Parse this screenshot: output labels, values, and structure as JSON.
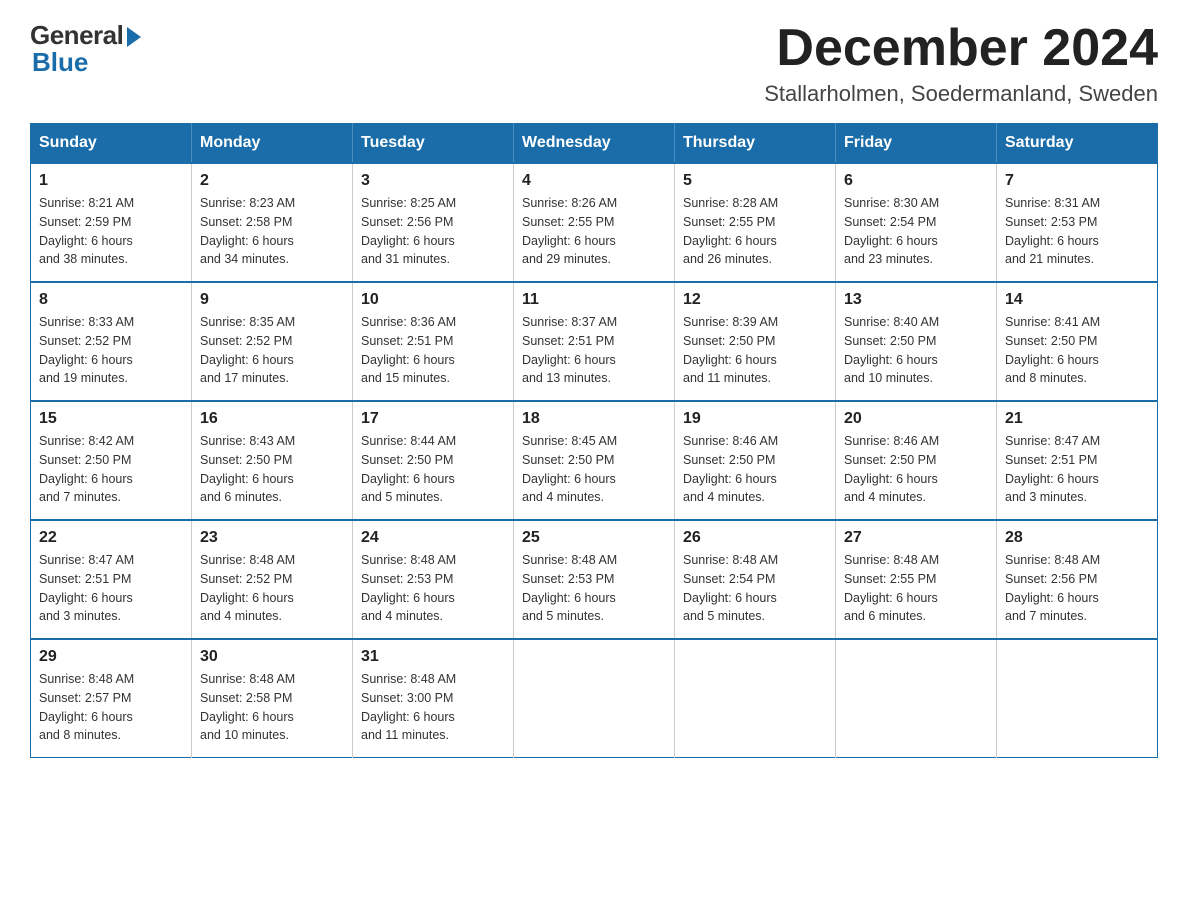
{
  "logo": {
    "general": "General",
    "blue": "Blue"
  },
  "header": {
    "month": "December 2024",
    "location": "Stallarholmen, Soedermanland, Sweden"
  },
  "weekdays": [
    "Sunday",
    "Monday",
    "Tuesday",
    "Wednesday",
    "Thursday",
    "Friday",
    "Saturday"
  ],
  "weeks": [
    [
      {
        "day": "1",
        "sunrise": "8:21 AM",
        "sunset": "2:59 PM",
        "daylight": "6 hours and 38 minutes."
      },
      {
        "day": "2",
        "sunrise": "8:23 AM",
        "sunset": "2:58 PM",
        "daylight": "6 hours and 34 minutes."
      },
      {
        "day": "3",
        "sunrise": "8:25 AM",
        "sunset": "2:56 PM",
        "daylight": "6 hours and 31 minutes."
      },
      {
        "day": "4",
        "sunrise": "8:26 AM",
        "sunset": "2:55 PM",
        "daylight": "6 hours and 29 minutes."
      },
      {
        "day": "5",
        "sunrise": "8:28 AM",
        "sunset": "2:55 PM",
        "daylight": "6 hours and 26 minutes."
      },
      {
        "day": "6",
        "sunrise": "8:30 AM",
        "sunset": "2:54 PM",
        "daylight": "6 hours and 23 minutes."
      },
      {
        "day": "7",
        "sunrise": "8:31 AM",
        "sunset": "2:53 PM",
        "daylight": "6 hours and 21 minutes."
      }
    ],
    [
      {
        "day": "8",
        "sunrise": "8:33 AM",
        "sunset": "2:52 PM",
        "daylight": "6 hours and 19 minutes."
      },
      {
        "day": "9",
        "sunrise": "8:35 AM",
        "sunset": "2:52 PM",
        "daylight": "6 hours and 17 minutes."
      },
      {
        "day": "10",
        "sunrise": "8:36 AM",
        "sunset": "2:51 PM",
        "daylight": "6 hours and 15 minutes."
      },
      {
        "day": "11",
        "sunrise": "8:37 AM",
        "sunset": "2:51 PM",
        "daylight": "6 hours and 13 minutes."
      },
      {
        "day": "12",
        "sunrise": "8:39 AM",
        "sunset": "2:50 PM",
        "daylight": "6 hours and 11 minutes."
      },
      {
        "day": "13",
        "sunrise": "8:40 AM",
        "sunset": "2:50 PM",
        "daylight": "6 hours and 10 minutes."
      },
      {
        "day": "14",
        "sunrise": "8:41 AM",
        "sunset": "2:50 PM",
        "daylight": "6 hours and 8 minutes."
      }
    ],
    [
      {
        "day": "15",
        "sunrise": "8:42 AM",
        "sunset": "2:50 PM",
        "daylight": "6 hours and 7 minutes."
      },
      {
        "day": "16",
        "sunrise": "8:43 AM",
        "sunset": "2:50 PM",
        "daylight": "6 hours and 6 minutes."
      },
      {
        "day": "17",
        "sunrise": "8:44 AM",
        "sunset": "2:50 PM",
        "daylight": "6 hours and 5 minutes."
      },
      {
        "day": "18",
        "sunrise": "8:45 AM",
        "sunset": "2:50 PM",
        "daylight": "6 hours and 4 minutes."
      },
      {
        "day": "19",
        "sunrise": "8:46 AM",
        "sunset": "2:50 PM",
        "daylight": "6 hours and 4 minutes."
      },
      {
        "day": "20",
        "sunrise": "8:46 AM",
        "sunset": "2:50 PM",
        "daylight": "6 hours and 4 minutes."
      },
      {
        "day": "21",
        "sunrise": "8:47 AM",
        "sunset": "2:51 PM",
        "daylight": "6 hours and 3 minutes."
      }
    ],
    [
      {
        "day": "22",
        "sunrise": "8:47 AM",
        "sunset": "2:51 PM",
        "daylight": "6 hours and 3 minutes."
      },
      {
        "day": "23",
        "sunrise": "8:48 AM",
        "sunset": "2:52 PM",
        "daylight": "6 hours and 4 minutes."
      },
      {
        "day": "24",
        "sunrise": "8:48 AM",
        "sunset": "2:53 PM",
        "daylight": "6 hours and 4 minutes."
      },
      {
        "day": "25",
        "sunrise": "8:48 AM",
        "sunset": "2:53 PM",
        "daylight": "6 hours and 5 minutes."
      },
      {
        "day": "26",
        "sunrise": "8:48 AM",
        "sunset": "2:54 PM",
        "daylight": "6 hours and 5 minutes."
      },
      {
        "day": "27",
        "sunrise": "8:48 AM",
        "sunset": "2:55 PM",
        "daylight": "6 hours and 6 minutes."
      },
      {
        "day": "28",
        "sunrise": "8:48 AM",
        "sunset": "2:56 PM",
        "daylight": "6 hours and 7 minutes."
      }
    ],
    [
      {
        "day": "29",
        "sunrise": "8:48 AM",
        "sunset": "2:57 PM",
        "daylight": "6 hours and 8 minutes."
      },
      {
        "day": "30",
        "sunrise": "8:48 AM",
        "sunset": "2:58 PM",
        "daylight": "6 hours and 10 minutes."
      },
      {
        "day": "31",
        "sunrise": "8:48 AM",
        "sunset": "3:00 PM",
        "daylight": "6 hours and 11 minutes."
      },
      null,
      null,
      null,
      null
    ]
  ],
  "labels": {
    "sunrise": "Sunrise:",
    "sunset": "Sunset:",
    "daylight": "Daylight:"
  }
}
